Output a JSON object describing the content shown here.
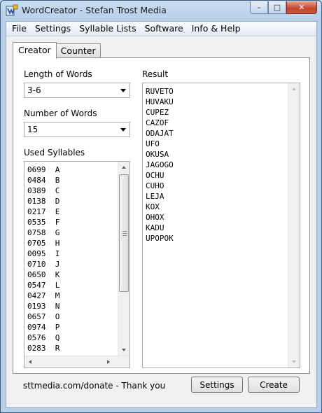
{
  "window": {
    "title": "WordCreator - Stefan Trost Media",
    "controls": {
      "minimize": "–",
      "maximize": "□",
      "close": "✕"
    }
  },
  "menu": [
    "File",
    "Settings",
    "Syllable Lists",
    "Software",
    "Info & Help"
  ],
  "tabs": [
    "Creator",
    "Counter"
  ],
  "creator": {
    "length_label": "Length of Words",
    "length_value": "3-6",
    "number_label": "Number of Words",
    "number_value": "15",
    "syllables_label": "Used Syllables",
    "syllables": [
      "0699  A",
      "0484  B",
      "0389  C",
      "0138  D",
      "0217  E",
      "0535  F",
      "0758  G",
      "0705  H",
      "0095  I",
      "0710  J",
      "0650  K",
      "0547  L",
      "0427  M",
      "0193  N",
      "0657  O",
      "0974  P",
      "0576  Q",
      "0283  R"
    ],
    "result_label": "Result",
    "results": [
      "RUVETO",
      "HUVAKU",
      "CUPEZ",
      "CAZOF",
      "ODAJAT",
      "UFO",
      "OKUSA",
      "JAGOGO",
      "OCHU",
      "CUHO",
      "LEJA",
      "KOX",
      "OHOX",
      "KADU",
      "UPOPOK"
    ]
  },
  "footer": {
    "donate_text": "sttmedia.com/donate - Thank you",
    "settings_button": "Settings",
    "create_button": "Create"
  },
  "colors": {
    "window_frame": "#b7cfe9",
    "client_bg": "#f0f0f0",
    "close_button": "#c4452e"
  },
  "icons": {
    "app": "app-icon",
    "combo_arrow": "chevron-down-icon"
  }
}
